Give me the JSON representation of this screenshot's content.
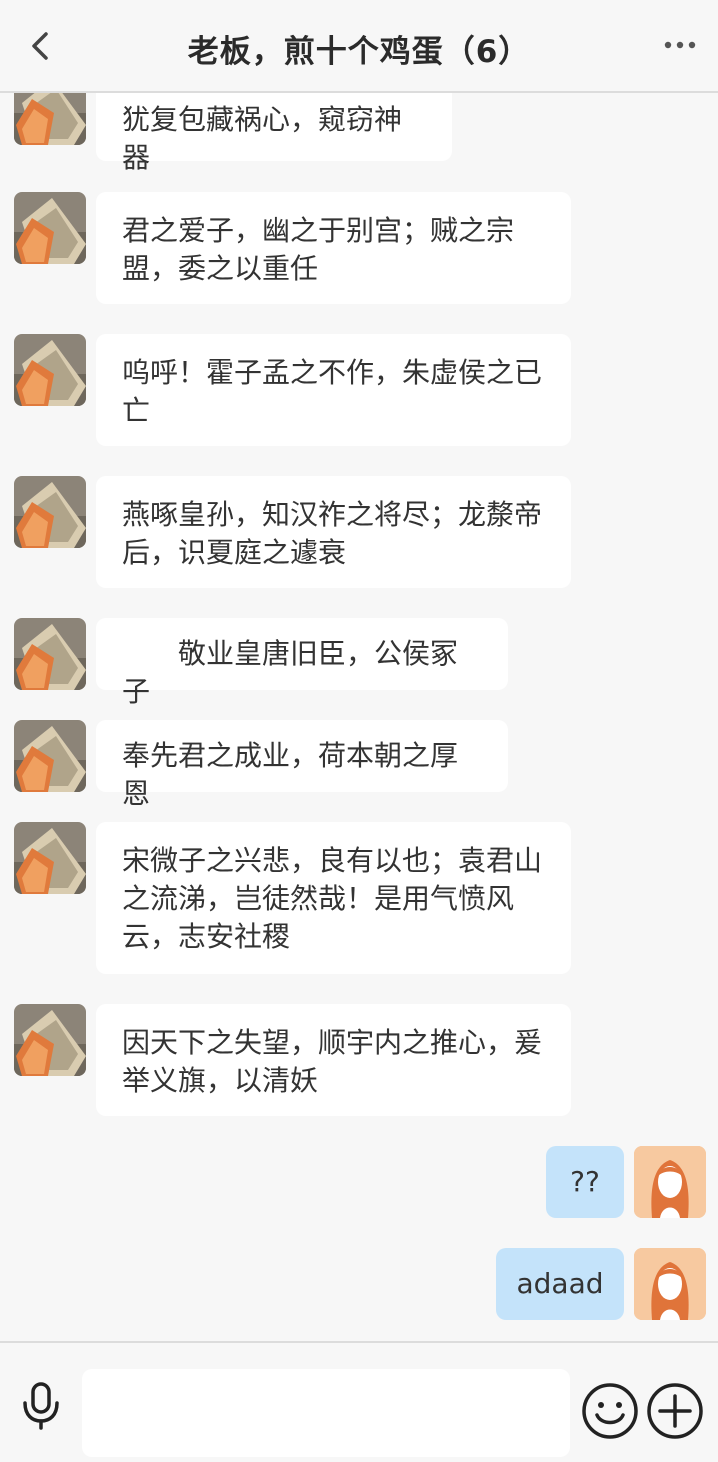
{
  "header": {
    "title": "老板，煎十个鸡蛋（6）",
    "back_icon": "chevron-left-icon",
    "more_icon": "more-horizontal-icon"
  },
  "messages": [
    {
      "side": "left",
      "text": "犹复包藏祸心，窥窃神器"
    },
    {
      "side": "left",
      "text": "君之爱子，幽之于别宫；贼之宗盟，委之以重任"
    },
    {
      "side": "left",
      "text": "呜呼！霍子孟之不作，朱虚侯之已亡"
    },
    {
      "side": "left",
      "text": "燕啄皇孙，知汉祚之将尽；龙漦帝后，识夏庭之遽衰"
    },
    {
      "side": "left",
      "text": "　　敬业皇唐旧臣，公侯冢子"
    },
    {
      "side": "left",
      "text": "奉先君之成业，荷本朝之厚恩"
    },
    {
      "side": "left",
      "text": "宋微子之兴悲，良有以也；袁君山之流涕，岂徒然哉！是用气愤风云，志安社稷"
    },
    {
      "side": "left",
      "text": "因天下之失望，顺宇内之推心，爰举义旗，以清妖"
    },
    {
      "side": "right",
      "text": "??"
    },
    {
      "side": "right",
      "text": "adaad"
    }
  ],
  "footer": {
    "input_value": "",
    "mic_icon": "microphone-icon",
    "emoji_icon": "smiley-icon",
    "plus_icon": "plus-circle-icon"
  },
  "colors": {
    "background": "#f7f7f7",
    "bubble_left": "#ffffff",
    "bubble_right": "#c4e3fa",
    "avatar_right_bg": "#f7c9a0"
  }
}
